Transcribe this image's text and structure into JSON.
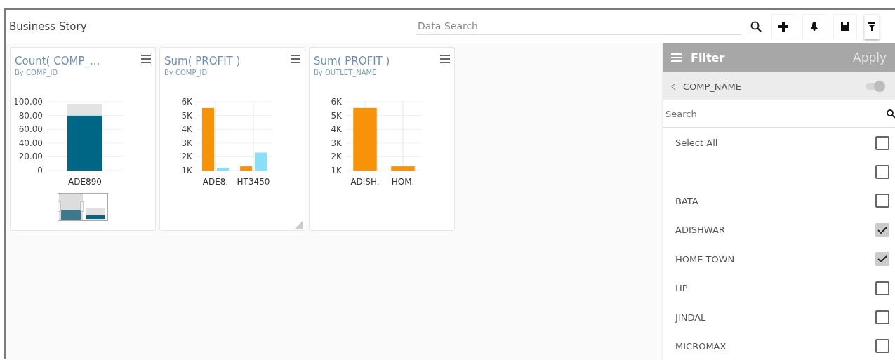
{
  "header": {
    "title": "Business Story",
    "search": {
      "placeholder": "Data Search"
    }
  },
  "cards": [
    {
      "title": "Count( COMP_...",
      "subtitle": "By COMP_ID",
      "navigator": true,
      "chart_data": {
        "type": "bar",
        "categories": [
          "ADE890"
        ],
        "series": [
          {
            "color": "#006685",
            "values": [
              80
            ]
          },
          {
            "color": "#e3e3e3",
            "values": [
              17
            ]
          }
        ],
        "stacked": true,
        "grid": true,
        "ylim": [
          0,
          100
        ],
        "yticks": [
          {
            "value": 0,
            "label": "0"
          },
          {
            "value": 20,
            "label": "20.00"
          },
          {
            "value": 40,
            "label": "40.00"
          },
          {
            "value": 60,
            "label": "60.00"
          },
          {
            "value": 80,
            "label": "80.00"
          },
          {
            "value": 100,
            "label": "100.00"
          }
        ]
      }
    },
    {
      "title": "Sum( PROFIT )",
      "subtitle": "By COMP_ID",
      "navigator": false,
      "chart_data": {
        "type": "bar",
        "categories": [
          "ADE8.",
          "HT3450"
        ],
        "series": [
          {
            "color": "#f79209",
            "values": [
              5550,
              1300
            ]
          },
          {
            "color": "#8adff8",
            "values": [
              1200,
              2300
            ]
          }
        ],
        "grid": true,
        "ylim": [
          1000,
          6000
        ],
        "yticks": [
          {
            "value": 1000,
            "label": "1K"
          },
          {
            "value": 2000,
            "label": "2K"
          },
          {
            "value": 3000,
            "label": "3K"
          },
          {
            "value": 4000,
            "label": "4K"
          },
          {
            "value": 5000,
            "label": "5K"
          },
          {
            "value": 6000,
            "label": "6K"
          }
        ]
      }
    },
    {
      "title": "Sum( PROFIT )",
      "subtitle": "By OUTLET_NAME",
      "navigator": false,
      "chart_data": {
        "type": "bar",
        "categories": [
          "ADISH.",
          "HOM."
        ],
        "series": [
          {
            "color": "#f79209",
            "values": [
              5550,
              1300
            ]
          }
        ],
        "grid": true,
        "ylim": [
          1000,
          6000
        ],
        "yticks": [
          {
            "value": 1000,
            "label": "1K"
          },
          {
            "value": 2000,
            "label": "2K"
          },
          {
            "value": 3000,
            "label": "3K"
          },
          {
            "value": 4000,
            "label": "4K"
          },
          {
            "value": 5000,
            "label": "5K"
          },
          {
            "value": 6000,
            "label": "6K"
          }
        ]
      }
    }
  ],
  "filter": {
    "title": "Filter",
    "apply": "Apply",
    "field": "COMP_NAME",
    "toggle": {
      "on": true
    },
    "search": {
      "placeholder": "Search"
    },
    "items": [
      {
        "label": "Select All",
        "checked": false
      },
      {
        "checked": false
      },
      {
        "label": "BATA",
        "checked": false
      },
      {
        "label": "ADISHWAR",
        "checked": true
      },
      {
        "label": "HOME TOWN",
        "checked": true
      },
      {
        "label": "HP",
        "checked": false
      },
      {
        "label": "JINDAL",
        "checked": false
      },
      {
        "label": "MICROMAX",
        "checked": false
      }
    ]
  }
}
